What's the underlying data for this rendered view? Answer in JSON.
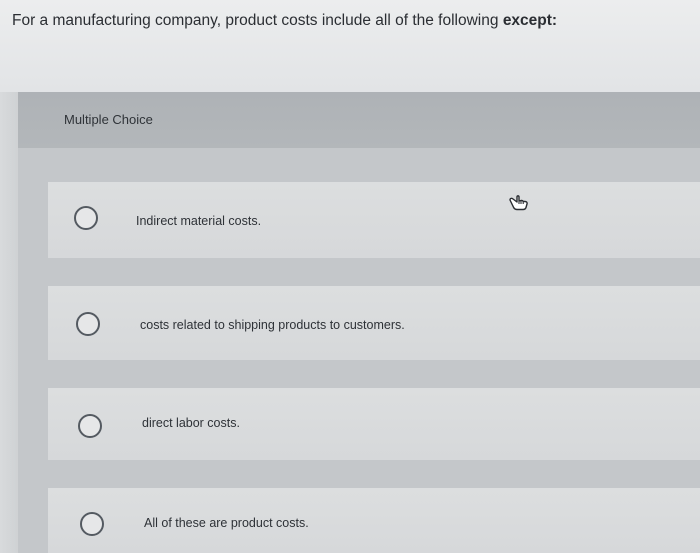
{
  "question": {
    "text_main": "For a manufacturing company, product costs include all of the following ",
    "text_bold": "except:"
  },
  "header": {
    "label": "Multiple Choice"
  },
  "options": [
    {
      "label": "Indirect material costs.",
      "selected": false
    },
    {
      "label": "costs related to shipping products to customers.",
      "selected": false
    },
    {
      "label": "direct labor costs.",
      "selected": false
    },
    {
      "label": "All of these are product costs.",
      "selected": false
    }
  ],
  "icons": {
    "cursor": "hand-pointer-icon"
  },
  "colors": {
    "page_background": "#c9ccce",
    "question_background": "#ecedee",
    "header_background": "#aeb2b6",
    "option_background": "#dcdedf",
    "radio_border": "#545a61"
  }
}
